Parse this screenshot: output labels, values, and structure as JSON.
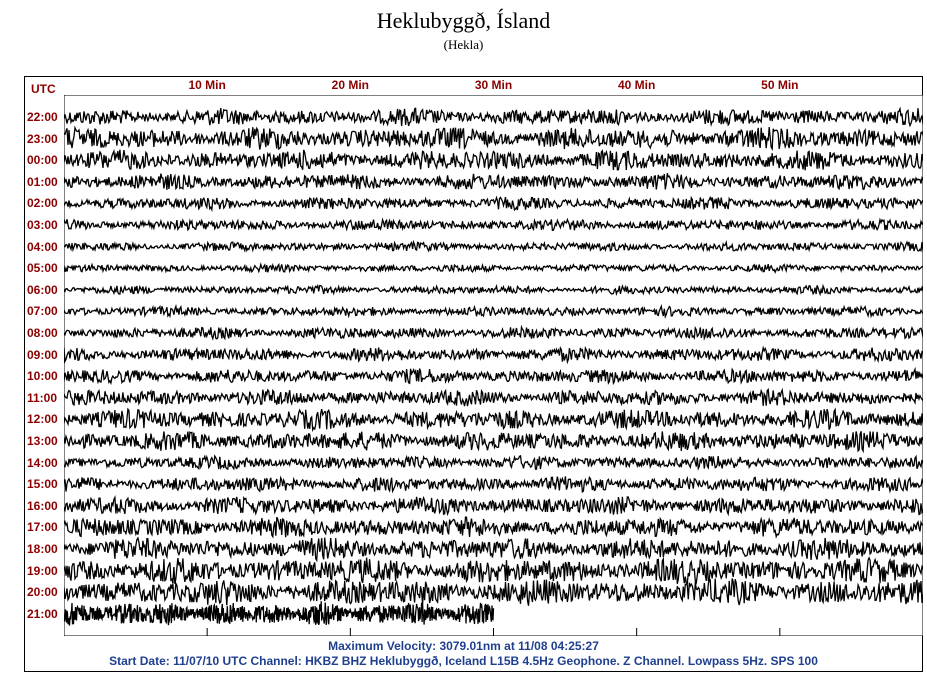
{
  "title": "Heklubyggð, Ísland",
  "subtitle": "(Hekla)",
  "chart_data": {
    "type": "helicorder",
    "x_unit_label": "UTC",
    "x_ticks": [
      {
        "value": 10,
        "label": "10 Min"
      },
      {
        "value": 20,
        "label": "20 Min"
      },
      {
        "value": 30,
        "label": "30 Min"
      },
      {
        "value": 40,
        "label": "40 Min"
      },
      {
        "value": 50,
        "label": "50 Min"
      }
    ],
    "xlim": [
      0,
      60
    ],
    "rows": [
      "22:00",
      "23:00",
      "00:00",
      "01:00",
      "02:00",
      "03:00",
      "04:00",
      "05:00",
      "06:00",
      "07:00",
      "08:00",
      "09:00",
      "10:00",
      "11:00",
      "12:00",
      "13:00",
      "14:00",
      "15:00",
      "16:00",
      "17:00",
      "18:00",
      "19:00",
      "20:00",
      "21:00"
    ],
    "row_amplitude": [
      0.62,
      0.8,
      0.72,
      0.58,
      0.45,
      0.4,
      0.32,
      0.28,
      0.3,
      0.35,
      0.42,
      0.5,
      0.52,
      0.58,
      0.72,
      0.7,
      0.48,
      0.55,
      0.65,
      0.72,
      0.8,
      0.92,
      0.95,
      0.85
    ],
    "last_row_data_end_min": 30,
    "trace_color": "#000000",
    "background_color": "#ffffff",
    "label_color": "#8b0000"
  },
  "footer": {
    "max_velocity": "Maximum Velocity: 3079.01nm at 11/08 04:25:27",
    "info": "Start Date: 11/07/10 UTC Channel: HKBZ  BHZ  Heklubyggð, Iceland  L15B 4.5Hz Geophone. Z Channel. Lowpass 5Hz. SPS 100"
  },
  "colors": {
    "axis_labels": "#8b0000",
    "footer_text": "#1f3f8f"
  }
}
